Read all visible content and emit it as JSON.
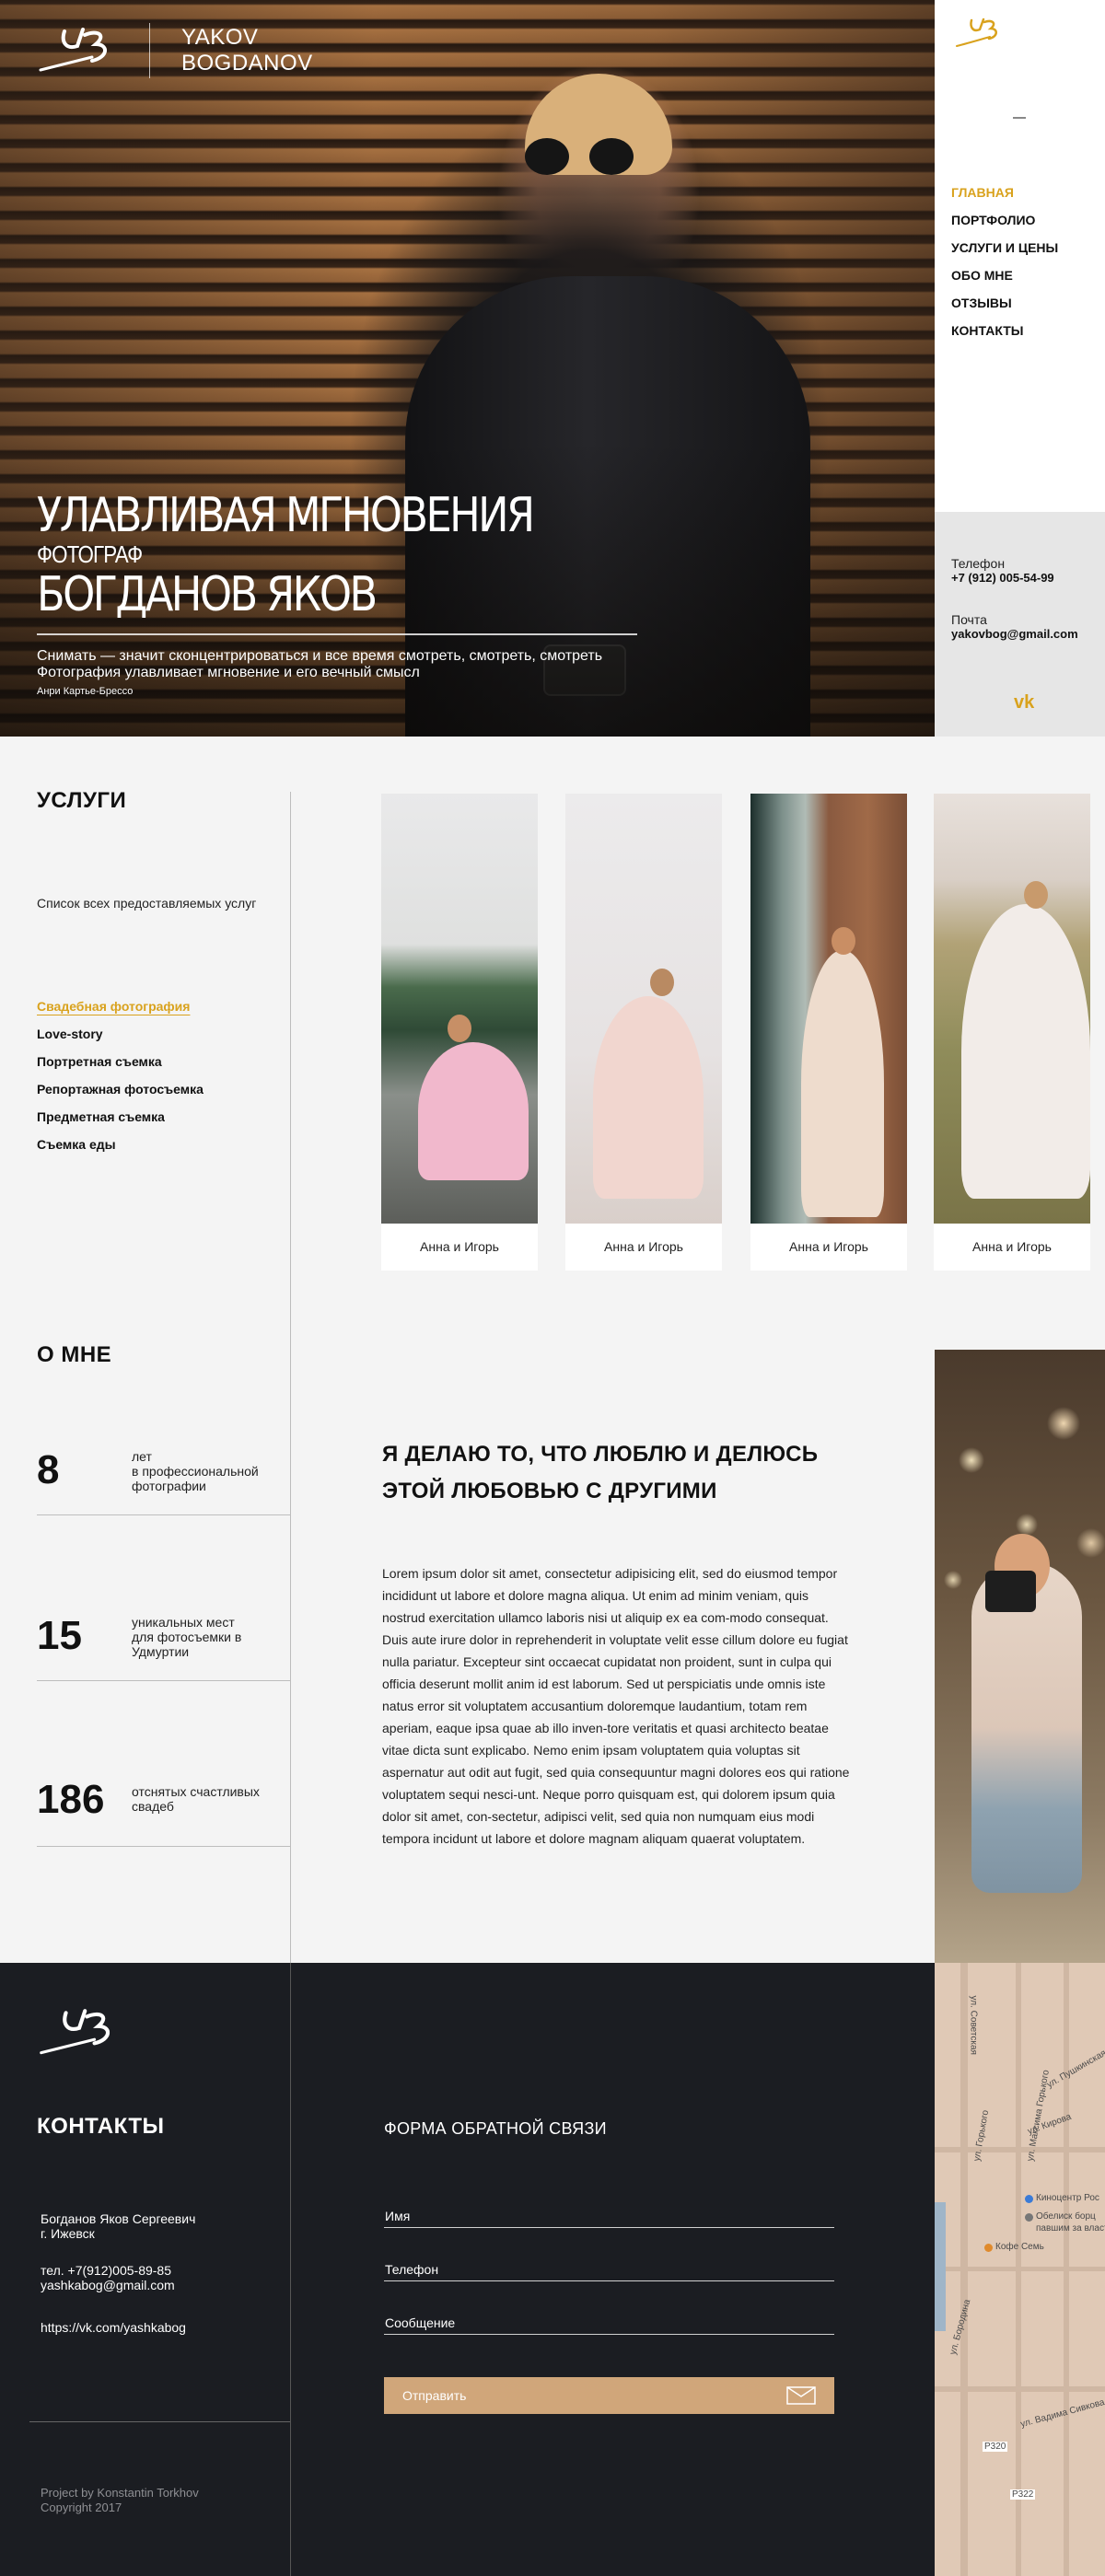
{
  "brand": {
    "name_line1": "YAKOV",
    "name_line2": "BOGDANOV"
  },
  "hero": {
    "title": "УЛАВЛИВАЯ МГНОВЕНИЯ",
    "subtitle": "ФОТОГРАФ",
    "name": "БОГДАНОВ ЯКОВ",
    "quote_line1": "Снимать — значит сконцентрироваться и все время смотреть, смотреть, смотреть",
    "quote_line2": "Фотография улавливает мгновение и его вечный смысл",
    "quote_author": "Анри Картье-Брессо"
  },
  "nav": {
    "items": [
      {
        "label": "ГЛАВНАЯ"
      },
      {
        "label": "ПОРТФОЛИО"
      },
      {
        "label": "УСЛУГИ И ЦЕНЫ"
      },
      {
        "label": "ОБО МНЕ"
      },
      {
        "label": "ОТЗЫВЫ"
      },
      {
        "label": "КОНТАКТЫ"
      }
    ],
    "active_color": "#d9a21d"
  },
  "sidebar_contact": {
    "phone_label": "Телефон",
    "phone": "+7 (912) 005-54-99",
    "email_label": "Почта",
    "email": "yakovbog@gmail.com",
    "vk_icon": "vk-icon"
  },
  "services": {
    "title": "УСЛУГИ",
    "description": "Список всех предоставляемых услуг",
    "items": [
      {
        "label": "Свадебная фотография"
      },
      {
        "label": "Love-story"
      },
      {
        "label": "Портретная съемка"
      },
      {
        "label": "Репортажная фотосъемка"
      },
      {
        "label": "Предметная съемка"
      },
      {
        "label": "Съемка еды"
      }
    ],
    "gallery": [
      {
        "caption": "Анна и Игорь"
      },
      {
        "caption": "Анна и Игорь"
      },
      {
        "caption": "Анна и Игорь"
      },
      {
        "caption": "Анна и Игорь"
      }
    ]
  },
  "about": {
    "title": "О МНЕ",
    "stats": [
      {
        "number": "8",
        "text": "лет\nв профессиональной\nфотографии"
      },
      {
        "number": "15",
        "text": "уникальных мест\nдля фотосъемки в\nУдмуртии"
      },
      {
        "number": "186",
        "text": "отснятых счастливых\nсвадеб"
      }
    ],
    "heading": "Я ДЕЛАЮ ТО, ЧТО ЛЮБЛЮ И ДЕЛЮСЬ ЭТОЙ ЛЮБОВЬЮ С ДРУГИМИ",
    "text": "Lorem ipsum dolor sit amet, consectetur adipisicing elit, sed do eiusmod tempor incididunt ut labore et dolore magna aliqua. Ut enim ad minim veniam, quis nostrud exercitation ullamco laboris nisi ut aliquip ex ea com-modo consequat. Duis aute irure dolor in reprehenderit in voluptate velit esse cillum dolore eu fugiat nulla pariatur. Excepteur sint occaecat cupidatat non proident, sunt in culpa qui officia deserunt mollit anim id est laborum. Sed ut perspiciatis unde omnis iste natus error sit voluptatem accusantium doloremque laudantium, totam rem aperiam, eaque ipsa quae ab illo inven-tore veritatis et quasi architecto beatae vitae dicta sunt explicabo. Nemo enim ipsam voluptatem quia voluptas sit aspernatur aut odit aut fugit, sed quia consequuntur magni dolores eos qui ratione voluptatem sequi nesci-unt. Neque porro quisquam est, qui dolorem ipsum quia dolor sit amet, con-sectetur, adipisci velit, sed quia non numquam eius modi tempora incidunt ut labore et dolore magnam aliquam quaerat voluptatem."
  },
  "contacts": {
    "title": "КОНТАКТЫ",
    "name_city": "Богданов Яков Сергеевич\nг. Ижевск",
    "phone_email": "тел. +7(912)005-89-85\nyashkabog@gmail.com",
    "vk": "https://vk.com/yashkabog",
    "credit": "Project by Konstantin Torkhov\nCopyright 2017",
    "form": {
      "title": "ФОРМА ОБРАТНОЙ СВЯЗИ",
      "name_placeholder": "Имя",
      "phone_placeholder": "Телефон",
      "message_placeholder": "Сообщение",
      "submit_label": "Отправить",
      "submit_icon": "envelope-icon"
    }
  },
  "map": {
    "labels": [
      {
        "text": "Киноцентр Рос"
      },
      {
        "text": "Обелиск борц"
      },
      {
        "text": "павшим за власт"
      },
      {
        "text": "Кофе Семь"
      },
      {
        "text": "ул. Кирова"
      },
      {
        "text": "ул. Советская"
      },
      {
        "text": "ул. Пушкинская"
      },
      {
        "text": "ул. Горького"
      },
      {
        "text": "ул. Максима Горького"
      },
      {
        "text": "ул. Бородина"
      },
      {
        "text": "ул. Вадима Сивкова"
      },
      {
        "text": "P322"
      },
      {
        "text": "P320"
      }
    ]
  }
}
